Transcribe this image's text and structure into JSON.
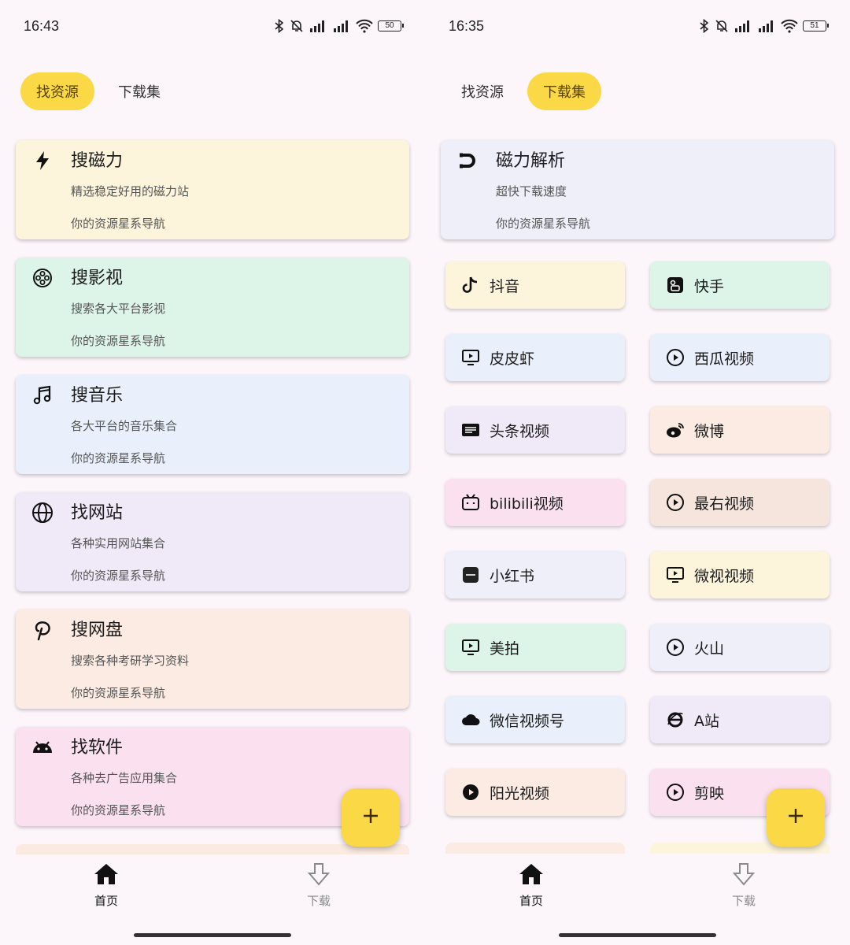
{
  "left": {
    "status": {
      "time": "16:43",
      "battery": "50"
    },
    "tabs": [
      {
        "label": "找资源",
        "active": true
      },
      {
        "label": "下载集",
        "active": false
      }
    ],
    "cards": [
      {
        "icon": "bolt-icon",
        "title": "搜磁力",
        "desc": "精选稳定好用的磁力站",
        "sub": "你的资源星系导航",
        "color": "#fdf4dc"
      },
      {
        "icon": "film-reel-icon",
        "title": "搜影视",
        "desc": "搜索各大平台影视",
        "sub": "你的资源星系导航",
        "color": "#dcf5e8"
      },
      {
        "icon": "music-note-icon",
        "title": "搜音乐",
        "desc": "各大平台的音乐集合",
        "sub": "你的资源星系导航",
        "color": "#e9f0fb"
      },
      {
        "icon": "globe-icon",
        "title": "找网站",
        "desc": "各种实用网站集合",
        "sub": "你的资源星系导航",
        "color": "#efe9f8"
      },
      {
        "icon": "pinterest-icon",
        "title": "搜网盘",
        "desc": "搜索各种考研学习资料",
        "sub": "你的资源星系导航",
        "color": "#fbebe2"
      },
      {
        "icon": "android-icon",
        "title": "找软件",
        "desc": "各种去广告应用集合",
        "sub": "你的资源星系导航",
        "color": "#fbe0ef"
      }
    ],
    "nav": [
      {
        "label": "首页",
        "icon": "home-icon",
        "active": true
      },
      {
        "label": "下载",
        "icon": "download-arrow-icon",
        "active": false
      }
    ]
  },
  "right": {
    "status": {
      "time": "16:35",
      "battery": "51"
    },
    "tabs": [
      {
        "label": "找资源",
        "active": false
      },
      {
        "label": "下载集",
        "active": true
      }
    ],
    "header_card": {
      "icon": "magnet-icon",
      "title": "磁力解析",
      "desc": "超快下载速度",
      "sub": "你的资源星系导航"
    },
    "grid": [
      {
        "icon": "tiktok-icon",
        "label": "抖音",
        "color": "#fdf4dc"
      },
      {
        "icon": "app-square-icon",
        "label": "快手",
        "color": "#dcf5e8"
      },
      {
        "icon": "tv-play-icon",
        "label": "皮皮虾",
        "color": "#e9f0fb"
      },
      {
        "icon": "play-circle-icon",
        "label": "西瓜视频",
        "color": "#e9f0fb"
      },
      {
        "icon": "toutiao-icon",
        "label": "头条视频",
        "color": "#efe9f8"
      },
      {
        "icon": "weibo-icon",
        "label": "微博",
        "color": "#fbebe2"
      },
      {
        "icon": "bilibili-icon",
        "label": "bilibili视频",
        "color": "#fbe0ef"
      },
      {
        "icon": "play-circle-icon",
        "label": "最右视频",
        "color": "#f6e5dc"
      },
      {
        "icon": "xiaohongshu-icon",
        "label": "小红书",
        "color": "#eeeff9"
      },
      {
        "icon": "tv-play-icon",
        "label": "微视视频",
        "color": "#fdf4dc"
      },
      {
        "icon": "tv-play-icon",
        "label": "美拍",
        "color": "#dcf5e8"
      },
      {
        "icon": "play-circle-icon",
        "label": "火山",
        "color": "#eeeff9"
      },
      {
        "icon": "cloud-icon",
        "label": "微信视频号",
        "color": "#e9f0fb"
      },
      {
        "icon": "ie-browser-icon",
        "label": "A站",
        "color": "#efe9f8"
      },
      {
        "icon": "play-filled-circle-icon",
        "label": "阳光视频",
        "color": "#fbebe2"
      },
      {
        "icon": "play-circle-icon",
        "label": "剪映",
        "color": "#fbe0ef"
      }
    ],
    "nav": [
      {
        "label": "首页",
        "icon": "home-icon",
        "active": true
      },
      {
        "label": "下载",
        "icon": "download-arrow-icon",
        "active": false
      }
    ]
  },
  "colors": {
    "accent": "#fbd846",
    "background": "#fcf6fb"
  }
}
